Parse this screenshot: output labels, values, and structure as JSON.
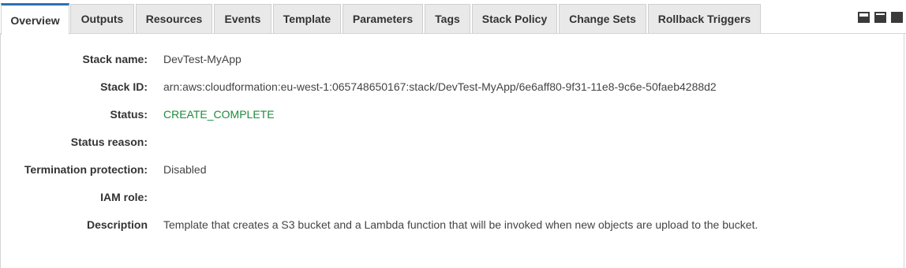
{
  "tabs": [
    {
      "label": "Overview",
      "active": true
    },
    {
      "label": "Outputs"
    },
    {
      "label": "Resources"
    },
    {
      "label": "Events"
    },
    {
      "label": "Template"
    },
    {
      "label": "Parameters"
    },
    {
      "label": "Tags"
    },
    {
      "label": "Stack Policy"
    },
    {
      "label": "Change Sets"
    },
    {
      "label": "Rollback Triggers"
    }
  ],
  "layout_icons": [
    "panel-bottom-large-icon",
    "panel-bottom-medium-icon",
    "panel-full-icon"
  ],
  "details": {
    "stack_name": {
      "label": "Stack name:",
      "value": "DevTest-MyApp"
    },
    "stack_id": {
      "label": "Stack ID:",
      "value": "arn:aws:cloudformation:eu-west-1:065748650167:stack/DevTest-MyApp/6e6aff80-9f31-11e8-9c6e-50faeb4288d2"
    },
    "status": {
      "label": "Status:",
      "value": "CREATE_COMPLETE"
    },
    "status_reason": {
      "label": "Status reason:",
      "value": ""
    },
    "termination_protection": {
      "label": "Termination protection:",
      "value": "Disabled"
    },
    "iam_role": {
      "label": "IAM role:",
      "value": ""
    },
    "description": {
      "label": "Description",
      "value": "Template that creates a S3 bucket and a Lambda function that will be invoked when new objects are upload to the bucket."
    }
  },
  "colors": {
    "active_tab_accent": "#2a72b5",
    "status_complete": "#1d8c3a"
  }
}
